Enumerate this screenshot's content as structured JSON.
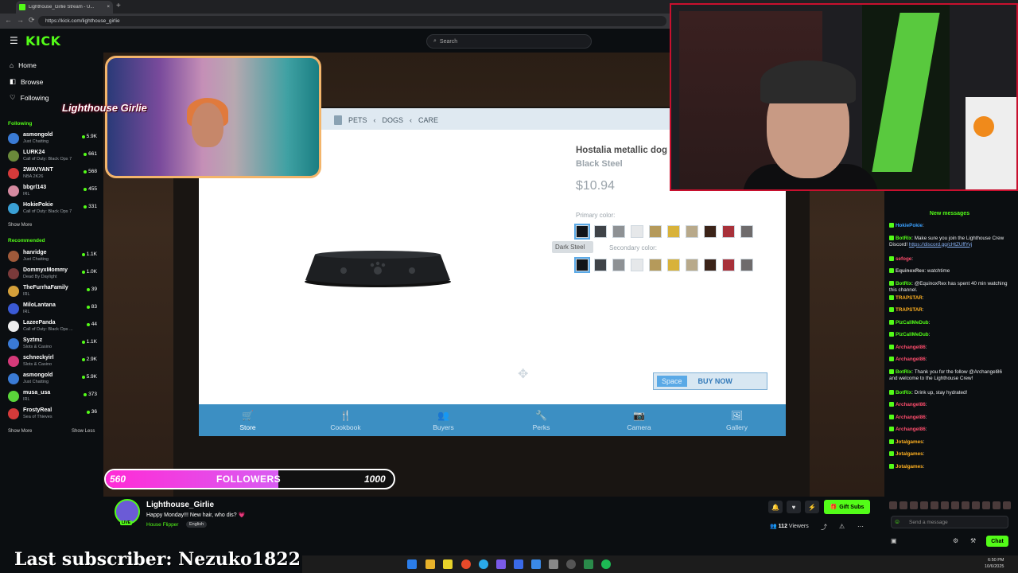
{
  "browser": {
    "tab_title": "Lighthouse_Girlie Stream - U...",
    "url": "https://kick.com/lighthouse_girlie"
  },
  "header": {
    "logo": "KICK",
    "search_placeholder": "Search"
  },
  "sidebar": {
    "nav": [
      {
        "label": "Home",
        "icon": "home-icon"
      },
      {
        "label": "Browse",
        "icon": "compass-icon"
      },
      {
        "label": "Following",
        "icon": "heart-icon"
      }
    ],
    "following_title": "Following",
    "following": [
      {
        "name": "asmongold",
        "game": "Just Chatting",
        "viewers": "5.9K",
        "color": "#3a7bd5"
      },
      {
        "name": "LURK24",
        "game": "Call of Duty: Black Ops 7",
        "viewers": "661",
        "color": "#6a8a3a"
      },
      {
        "name": "2WAVYANT",
        "game": "NBA 2K26",
        "viewers": "568",
        "color": "#d53a3a"
      },
      {
        "name": "bbgrl143",
        "game": "IRL",
        "viewers": "455",
        "color": "#d58aa0"
      },
      {
        "name": "HokiePokie",
        "game": "Call of Duty: Black Ops 7",
        "viewers": "331",
        "color": "#3aa0d5"
      }
    ],
    "following_more": "Show More",
    "recommended_title": "Recommended",
    "recommended": [
      {
        "name": "hanridge",
        "game": "Just Chatting",
        "viewers": "1.1K",
        "color": "#a05a3a"
      },
      {
        "name": "DommyxMommy",
        "game": "Dead By Daylight",
        "viewers": "1.0K",
        "color": "#7a3a3a"
      },
      {
        "name": "TheFurrhaFamily",
        "game": "IRL",
        "viewers": "39",
        "color": "#d5a03a"
      },
      {
        "name": "MiloLantana",
        "game": "IRL",
        "viewers": "83",
        "color": "#3a5ad5"
      },
      {
        "name": "LazeePanda",
        "game": "Call of Duty: Black Ops ...",
        "viewers": "44",
        "color": "#eeeeee"
      },
      {
        "name": "Syztmz",
        "game": "Slots & Casino",
        "viewers": "1.1K",
        "color": "#3a7ad5"
      },
      {
        "name": "schneckyirl",
        "game": "Slots & Casino",
        "viewers": "2.9K",
        "color": "#d53a7a"
      },
      {
        "name": "asmongold",
        "game": "Just Chatting",
        "viewers": "5.9K",
        "color": "#3a7bd5"
      },
      {
        "name": "musa_usa",
        "game": "IRL",
        "viewers": "373",
        "color": "#5ad53a"
      },
      {
        "name": "FrostyReal",
        "game": "Sea of Thieves",
        "viewers": "36",
        "color": "#d53a3a"
      }
    ],
    "recommended_more": "Show More",
    "recommended_less": "Show Less"
  },
  "game": {
    "breadcrumbs": [
      "PETS",
      "DOGS",
      "CARE"
    ],
    "product_name": "Hostalia metallic dog bowl",
    "product_variant": "Black Steel",
    "product_price": "$10.94",
    "primary_label": "Primary color:",
    "secondary_label": "Secondary color:",
    "tooltip": "Dark Steel",
    "swatch_colors": [
      "#111418",
      "#3f4348",
      "#8e9194",
      "#e6e8ea",
      "#b59a5b",
      "#d8b23a",
      "#b8a98a",
      "#3b2318",
      "#a8313a",
      "#6e6b6c"
    ],
    "buy_key": "Space",
    "buy_label": "BUY NOW",
    "tabs": [
      {
        "label": "Store",
        "icon": "cart-icon",
        "glyph": "🛒"
      },
      {
        "label": "Cookbook",
        "icon": "cutlery-icon",
        "glyph": "🍴"
      },
      {
        "label": "Buyers",
        "icon": "people-icon",
        "glyph": "👥"
      },
      {
        "label": "Perks",
        "icon": "wrench-icon",
        "glyph": "🔧"
      },
      {
        "label": "Camera",
        "icon": "camera-icon",
        "glyph": "📷"
      },
      {
        "label": "Gallery",
        "icon": "image-icon",
        "glyph": "🖼"
      }
    ]
  },
  "overlay": {
    "cam1_logo": "Lighthouse Girlie",
    "followers_start": "560",
    "followers_label": "FOLLOWERS",
    "followers_goal": "1000",
    "followers_progress": 0.6,
    "last_subscriber": "Last subscriber: Nezuko1822"
  },
  "channel": {
    "name": "Lighthouse_Girlie",
    "title": "Happy Monday!!! New hair, who dis? 💗",
    "game": "House Flipper",
    "language": "English",
    "live_badge": "LIVE",
    "viewers": "112",
    "viewers_label": "Viewers",
    "gift_label": "Gift Subs"
  },
  "chat": {
    "new_messages": "New messages",
    "messages": [
      {
        "user": "HokiePokie",
        "text": "",
        "color": "#3aa0ff"
      },
      {
        "user": "BotRix",
        "text": "Make sure you join the Lighthouse Crew Discord!",
        "link": "https://discord.gg/cHtZUffYvj",
        "color": "#53fc18"
      },
      {
        "user": "sefoge",
        "text": "",
        "color": "#ff4d6d"
      },
      {
        "user": "EquinoxRex",
        "text": "watchtime",
        "color": "#cccccc"
      },
      {
        "user": "BotRix",
        "text": "@EquinoxRex has spent 40 min watching this channel.",
        "color": "#53fc18"
      },
      {
        "user": "TRAPSTAR",
        "text": "",
        "color": "#ffb020"
      },
      {
        "user": "TRAPSTAR",
        "text": "",
        "color": "#ffb020"
      },
      {
        "user": "PlzCallMeDub",
        "text": "",
        "color": "#53fc18"
      },
      {
        "user": "PlzCallMeDub",
        "text": "",
        "color": "#53fc18"
      },
      {
        "user": "Archangel86",
        "text": "",
        "color": "#ff4d6d"
      },
      {
        "user": "Archangel86",
        "text": "",
        "color": "#ff4d6d"
      },
      {
        "user": "BotRix",
        "text": "Thank you for the follow @Archangel86 and welcome to the Lighthouse Crew!",
        "color": "#53fc18"
      },
      {
        "user": "BotRix",
        "text": "Drink up, stay hydrated!",
        "color": "#53fc18"
      },
      {
        "user": "Archangel86",
        "text": "",
        "color": "#ff4d6d"
      },
      {
        "user": "Archangel86",
        "text": "",
        "color": "#ff4d6d"
      },
      {
        "user": "Archangel86",
        "text": "",
        "color": "#ff4d6d"
      },
      {
        "user": "Jotalgames",
        "text": "",
        "color": "#ffb020"
      },
      {
        "user": "Jotalgames",
        "text": "",
        "color": "#ffb020"
      },
      {
        "user": "Jotalgames",
        "text": "",
        "color": "#ffb020"
      }
    ],
    "input_placeholder": "Send a message",
    "send_label": "Chat"
  },
  "taskbar": {
    "time": "6:50 PM",
    "date": "10/6/2025"
  },
  "colors": {
    "brand": "#53fc18",
    "game_tabs": "#3c8fc3"
  }
}
